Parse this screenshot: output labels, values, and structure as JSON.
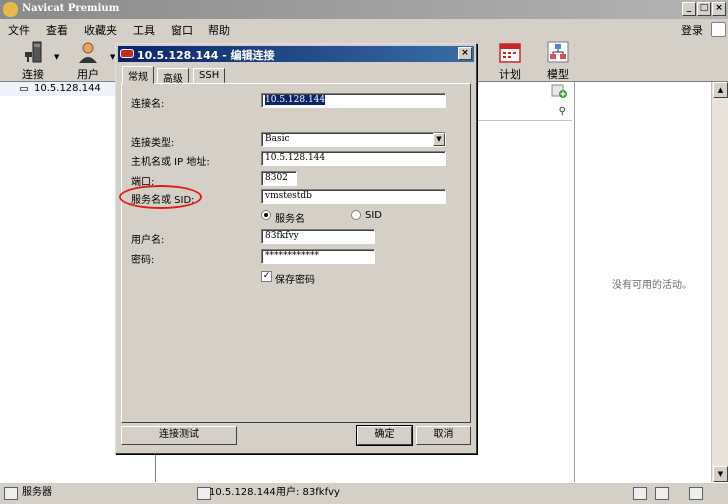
{
  "window": {
    "title": "Navicat Premium"
  },
  "menu": {
    "items": [
      "文件",
      "查看",
      "收藏夹",
      "工具",
      "窗口",
      "帮助"
    ],
    "login": "登录"
  },
  "toolbar": {
    "connect": "连接",
    "user": "用户",
    "schedule": "计划",
    "model": "模型"
  },
  "sidebar": {
    "connection": "10.5.128.144"
  },
  "dialog": {
    "title": "10.5.128.144 - 编辑连接",
    "tabs": [
      "常规",
      "高级",
      "SSH"
    ],
    "fields": {
      "conn_name_label": "连接名:",
      "conn_name_value": "10.5.128.144",
      "conn_type_label": "连接类型:",
      "conn_type_value": "Basic",
      "host_label": "主机名或 IP 地址:",
      "host_value": "10.5.128.144",
      "port_label": "端口:",
      "port_value": "8302",
      "service_label": "服务名或 SID:",
      "service_value": "vmstestdb",
      "radio_service": "服务名",
      "radio_sid": "SID",
      "user_label": "用户名:",
      "user_value": "83fkfvy",
      "password_label": "密码:",
      "password_value": "************",
      "save_password": "保存密码"
    },
    "buttons": {
      "test": "连接测试",
      "ok": "确定",
      "cancel": "取消"
    }
  },
  "right_panel": {
    "empty": "没有可用的活动。"
  },
  "status": {
    "server": "服务器",
    "connection": "10.5.128.144",
    "user": "用户: 83fkfvy"
  },
  "colors": {
    "annotation": "#e11c1c",
    "dialog_title": "#0a246a"
  }
}
